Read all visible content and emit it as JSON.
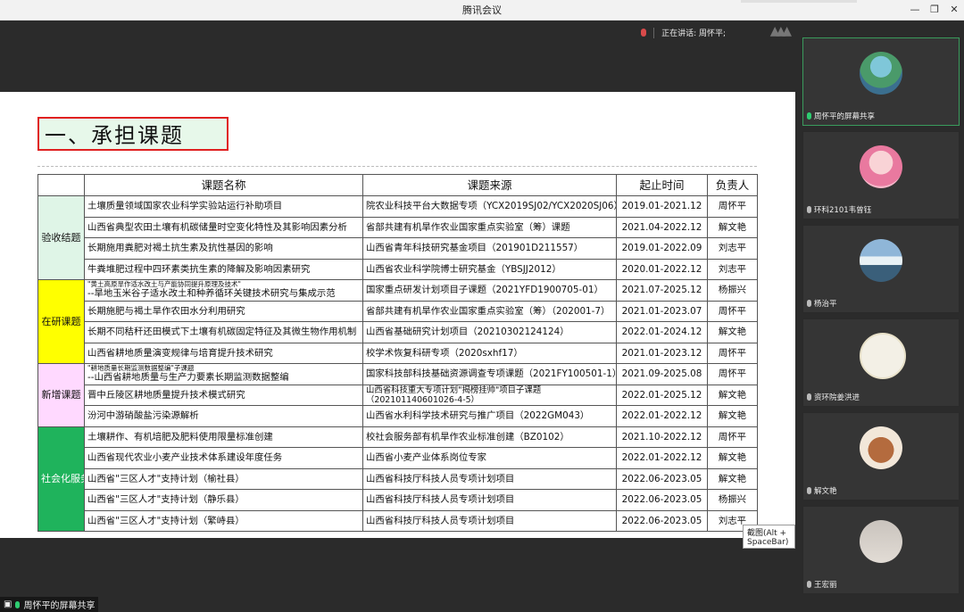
{
  "window": {
    "title": "腾讯会议"
  },
  "status": {
    "speaking": "正在讲话: 周怀平;"
  },
  "slide": {
    "heading": "一、承担课题",
    "headers": [
      "课题名称",
      "课题来源",
      "起止时间",
      "负责人"
    ],
    "groups": [
      {
        "category": "验收结题",
        "color": "#dff5e7",
        "rows": [
          {
            "name": "土壤质量领域国家农业科学实验站运行补助项目",
            "source": "院农业科技平台大数据专项（YCX2019SJ02/YCX2020SJ06）",
            "period": "2019.01-2021.12",
            "person": "周怀平"
          },
          {
            "name": "山西省典型农田土壤有机碳储量时空变化特性及其影响因素分析",
            "source": "省部共建有机旱作农业国家重点实验室（筹）课题",
            "period": "2021.04-2022.12",
            "person": "解文艳"
          },
          {
            "name": "长期施用粪肥对褐土抗生素及抗性基因的影响",
            "source": "山西省青年科技研究基金项目（201901D211557）",
            "period": "2019.01-2022.09",
            "person": "刘志平"
          },
          {
            "name": "牛粪堆肥过程中四环素类抗生素的降解及影响因素研究",
            "source": "山西省农业科学院博士研究基金（YBSJJ2012）",
            "period": "2020.01-2022.12",
            "person": "刘志平"
          }
        ]
      },
      {
        "category": "在研课题",
        "color": "#ffff00",
        "rows": [
          {
            "sub": "\"黄土高原旱作适水改土与产能协同提升原理及技术\"",
            "name": "--旱地玉米谷子适水改土和种养循环关键技术研究与集成示范",
            "source": "国家重点研发计划项目子课题（2021YFD1900705-01）",
            "period": "2021.07-2025.12",
            "person": "杨振兴"
          },
          {
            "name": "长期施肥与褐土旱作农田水分利用研究",
            "source": "省部共建有机旱作农业国家重点实验室（筹）（202001-7）",
            "period": "2021.01-2023.07",
            "person": "周怀平"
          },
          {
            "name": "长期不同秸秆还田模式下土壤有机碳固定特征及其微生物作用机制",
            "source": "山西省基础研究计划项目（20210302124124）",
            "period": "2022.01-2024.12",
            "person": "解文艳"
          },
          {
            "name": "山西省耕地质量演变规律与培育提升技术研究",
            "source": "校学术恢复科研专项（2020sxhf17）",
            "period": "2021.01-2023.12",
            "person": "周怀平"
          }
        ]
      },
      {
        "category": "新增课题",
        "color": "#ffd9ff",
        "rows": [
          {
            "sub": "\"耕地质量长期监测数据整编\"子课题",
            "name": "--山西省耕地质量与生产力要素长期监测数据整编",
            "source": "国家科技部科技基础资源调查专项课题（2021FY100501-1）",
            "period": "2021.09-2025.08",
            "person": "周怀平"
          },
          {
            "name": "晋中丘陵区耕地质量提升技术模式研究",
            "source": "山西省科技重大专项计划\"揭榜挂帅\"项目子课题",
            "source2": "（202101140601026-4-5）",
            "period": "2022.01-2025.12",
            "person": "解文艳"
          },
          {
            "name": "汾河中游硝酸盐污染源解析",
            "source": "山西省水利科学技术研究与推广项目（2022GM043）",
            "period": "2022.01-2022.12",
            "person": "解文艳"
          }
        ]
      },
      {
        "category": "社会化服务项目",
        "color": "#1fb35c",
        "rows": [
          {
            "name": "土壤耕作、有机培肥及肥料使用限量标准创建",
            "source": "校社会服务部有机旱作农业标准创建（BZ0102）",
            "period": "2021.10-2022.12",
            "person": "周怀平"
          },
          {
            "name": "山西省现代农业小麦产业技术体系建设年度任务",
            "source": "山西省小麦产业体系岗位专家",
            "period": "2022.01-2022.12",
            "person": "解文艳"
          },
          {
            "name": "山西省\"三区人才\"支持计划（榆社县）",
            "source": "山西省科技厅科技人员专项计划项目",
            "period": "2022.06-2023.05",
            "person": "解文艳"
          },
          {
            "name": "山西省\"三区人才\"支持计划（静乐县）",
            "source": "山西省科技厅科技人员专项计划项目",
            "period": "2022.06-2023.05",
            "person": "杨振兴"
          },
          {
            "name": "山西省\"三区人才\"支持计划（繁峙县）",
            "source": "山西省科技厅科技人员专项计划项目",
            "period": "2022.06-2023.05",
            "person": "刘志平"
          }
        ]
      }
    ]
  },
  "tooltip": "截图(Alt + SpaceBar)",
  "share_label": "周怀平的屏幕共享",
  "participants": [
    {
      "name": "周怀平的屏幕共享",
      "active": true
    },
    {
      "name": "环科2101韦曾钰",
      "active": false
    },
    {
      "name": "杨治平",
      "active": false
    },
    {
      "name": "资环院姜洪进",
      "active": false
    },
    {
      "name": "解文艳",
      "active": false
    },
    {
      "name": "王宏丽",
      "active": false
    }
  ]
}
